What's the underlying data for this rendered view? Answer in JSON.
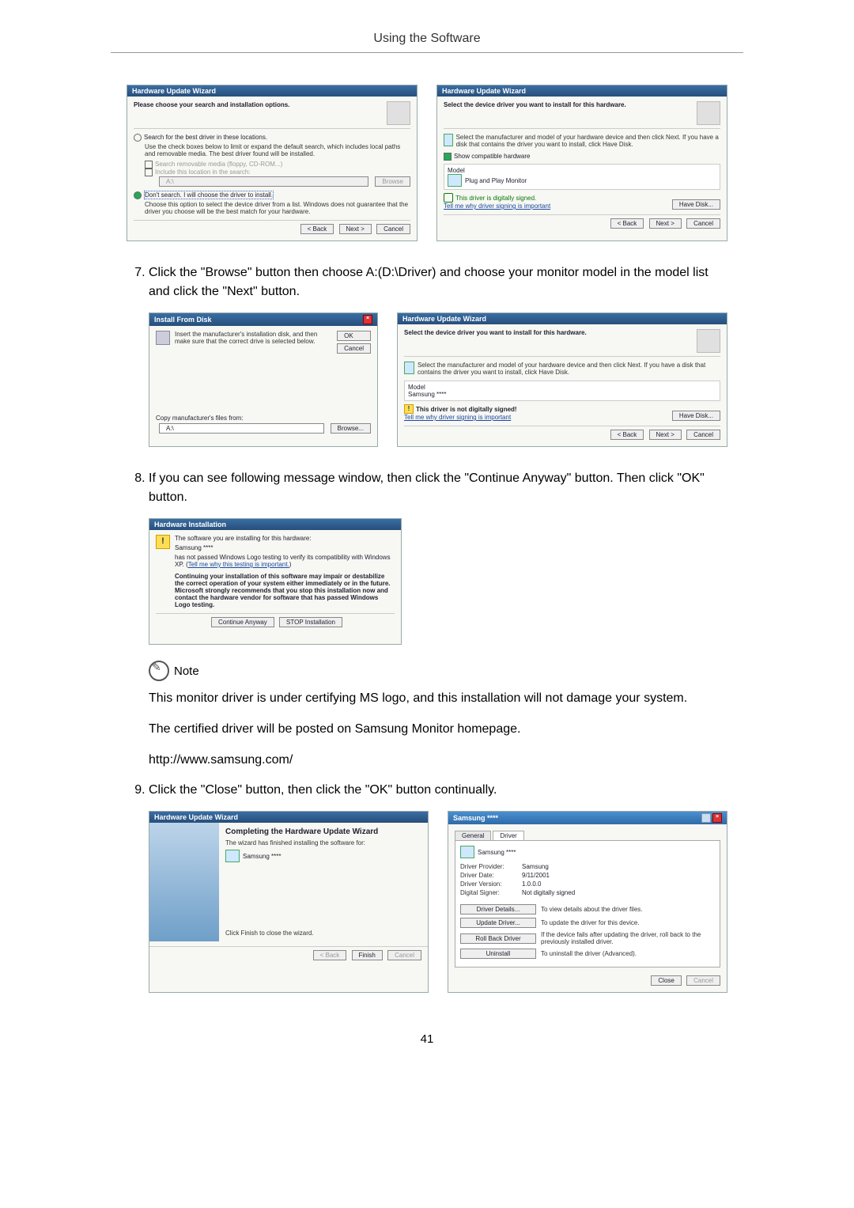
{
  "header": "Using the Software",
  "page_number": "41",
  "steps": {
    "s7": {
      "num": "7",
      "text": "Click the \"Browse\" button then choose A:(D:\\Driver) and choose your monitor model in the model list and click the \"Next\" button."
    },
    "s8": {
      "num": "8",
      "text": "If you can see following message window, then click the \"Continue Anyway\" button. Then click \"OK\" button."
    },
    "s9": {
      "num": "9",
      "text": "Click the \"Close\" button, then click the \"OK\" button continually."
    }
  },
  "note": {
    "label": "Note",
    "p1": "This monitor driver is under certifying MS logo, and this installation will not damage your system.",
    "p2": "The certified driver will be posted on Samsung Monitor homepage.",
    "p3": "http://www.samsung.com/"
  },
  "wiz1": {
    "title": "Hardware Update Wizard",
    "head": "Please choose your search and installation options.",
    "opt1": "Search for the best driver in these locations.",
    "opt1_desc": "Use the check boxes below to limit or expand the default search, which includes local paths and removable media. The best driver found will be installed.",
    "chk1": "Search removable media (floppy, CD-ROM...)",
    "chk2": "Include this location in the search:",
    "path": "A:\\",
    "browse": "Browse",
    "opt2": "Don't search. I will choose the driver to install.",
    "opt2_desc": "Choose this option to select the device driver from a list. Windows does not guarantee that the driver you choose will be the best match for your hardware.",
    "back": "< Back",
    "next": "Next >",
    "cancel": "Cancel"
  },
  "wiz2": {
    "title": "Hardware Update Wizard",
    "head": "Select the device driver you want to install for this hardware.",
    "desc": "Select the manufacturer and model of your hardware device and then click Next. If you have a disk that contains the driver you want to install, click Have Disk.",
    "chk": "Show compatible hardware",
    "model_h": "Model",
    "model_v": "Plug and Play Monitor",
    "signed": "This driver is digitally signed.",
    "tell": "Tell me why driver signing is important",
    "have_disk": "Have Disk...",
    "back": "< Back",
    "next": "Next >",
    "cancel": "Cancel"
  },
  "install_from_disk": {
    "title": "Install From Disk",
    "desc": "Insert the manufacturer's installation disk, and then make sure that the correct drive is selected below.",
    "ok": "OK",
    "cancel": "Cancel",
    "copy": "Copy manufacturer's files from:",
    "path": "A:\\",
    "browse": "Browse..."
  },
  "wiz3": {
    "title": "Hardware Update Wizard",
    "head": "Select the device driver you want to install for this hardware.",
    "desc": "Select the manufacturer and model of your hardware device and then click Next. If you have a disk that contains the driver you want to install, click Have Disk.",
    "model_h": "Model",
    "model_v": "Samsung ****",
    "unsigned": "This driver is not digitally signed!",
    "tell": "Tell me why driver signing is important",
    "have_disk": "Have Disk...",
    "back": "< Back",
    "next": "Next >",
    "cancel": "Cancel"
  },
  "hwinst": {
    "title": "Hardware Installation",
    "l1": "The software you are installing for this hardware:",
    "l2": "Samsung ****",
    "l3": "has not passed Windows Logo testing to verify its compatibility with Windows XP. (",
    "l3link": "Tell me why this testing is important.",
    "l3end": ")",
    "bold": "Continuing your installation of this software may impair or destabilize the correct operation of your system either immediately or in the future. Microsoft strongly recommends that you stop this installation now and contact the hardware vendor for software that has passed Windows Logo testing.",
    "cont": "Continue Anyway",
    "stop": "STOP Installation"
  },
  "wiz4": {
    "title": "Hardware Update Wizard",
    "head": "Completing the Hardware Update Wizard",
    "desc": "The wizard has finished installing the software for:",
    "dev": "Samsung ****",
    "finish_hint": "Click Finish to close the wizard.",
    "back": "< Back",
    "finish": "Finish",
    "cancel": "Cancel"
  },
  "props": {
    "title": "Samsung ****",
    "tab_general": "General",
    "tab_driver": "Driver",
    "dev": "Samsung ****",
    "provider_k": "Driver Provider:",
    "provider_v": "Samsung",
    "date_k": "Driver Date:",
    "date_v": "9/11/2001",
    "ver_k": "Driver Version:",
    "ver_v": "1.0.0.0",
    "signer_k": "Digital Signer:",
    "signer_v": "Not digitally signed",
    "btn_details": "Driver Details...",
    "btn_details_d": "To view details about the driver files.",
    "btn_update": "Update Driver...",
    "btn_update_d": "To update the driver for this device.",
    "btn_rollback": "Roll Back Driver",
    "btn_rollback_d": "If the device fails after updating the driver, roll back to the previously installed driver.",
    "btn_uninstall": "Uninstall",
    "btn_uninstall_d": "To uninstall the driver (Advanced).",
    "close": "Close",
    "cancel": "Cancel"
  }
}
